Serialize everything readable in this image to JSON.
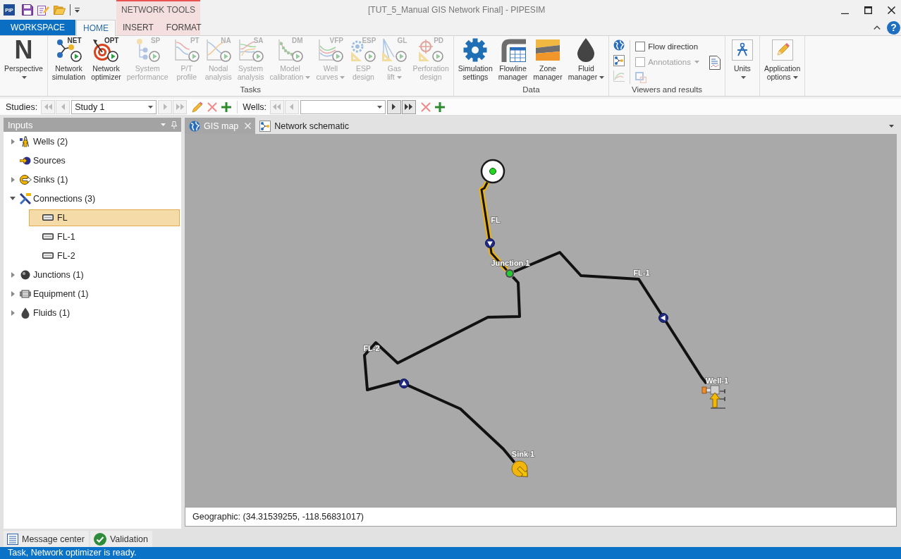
{
  "title_bar": {
    "app_logo": "PIP",
    "title": "[TUT_5_Manual GIS Network Final] - PIPESIM",
    "context_group": {
      "label": "NETWORK TOOLS"
    }
  },
  "ribbon_tabs": [
    {
      "label": "WORKSPACE",
      "kind": "backstage",
      "selected": false
    },
    {
      "label": "HOME",
      "kind": "normal",
      "selected": true
    },
    {
      "label": "INSERT",
      "kind": "contextual",
      "selected": false
    },
    {
      "label": "FORMAT",
      "kind": "contextual",
      "selected": false
    }
  ],
  "help": "?",
  "ribbon_groups": [
    {
      "kind": "large",
      "buttons": [
        {
          "kind": "perspective",
          "glyph": "N",
          "label": "Perspective",
          "dropdown": true,
          "disabled": false
        }
      ]
    },
    {
      "kind": "large",
      "label": "Tasks",
      "buttons": [
        {
          "kind": "network",
          "code": "NET",
          "label": "Network simulation",
          "dropdown": false,
          "disabled": false
        },
        {
          "kind": "target",
          "code": "OPT",
          "label": "Network optimizer",
          "dropdown": false,
          "disabled": false
        },
        {
          "kind": "system",
          "code": "SP",
          "label": "System performance",
          "dropdown": false,
          "disabled": true
        },
        {
          "kind": "profile",
          "code": "PT",
          "label": "P/T profile",
          "dropdown": false,
          "disabled": true
        },
        {
          "kind": "nodal",
          "code": "NA",
          "label": "Nodal analysis",
          "dropdown": false,
          "disabled": true
        },
        {
          "kind": "sensitivity",
          "code": "SA",
          "label": "System analysis",
          "dropdown": false,
          "disabled": true
        },
        {
          "kind": "calibration",
          "code": "DM",
          "label": "Model calibration",
          "dropdown": true,
          "disabled": true
        },
        {
          "kind": "curves",
          "code": "VFP",
          "label": "Well curves",
          "dropdown": true,
          "disabled": true
        },
        {
          "kind": "esp",
          "code": "ESP",
          "label": "ESP design",
          "dropdown": false,
          "disabled": true
        },
        {
          "kind": "gaslift",
          "code": "GL",
          "label": "Gas lift",
          "dropdown": true,
          "disabled": true
        },
        {
          "kind": "perforation",
          "code": "PD",
          "label": "Perforation design",
          "dropdown": false,
          "disabled": true
        }
      ]
    },
    {
      "kind": "large",
      "label": "Data",
      "buttons": [
        {
          "kind": "settings",
          "label": "Simulation settings",
          "dropdown": false,
          "disabled": false
        },
        {
          "kind": "flowlines",
          "label": "Flowline manager",
          "dropdown": false,
          "disabled": false
        },
        {
          "kind": "zones",
          "label": "Zone manager",
          "dropdown": false,
          "disabled": false
        },
        {
          "kind": "fluids",
          "label": "Fluid manager",
          "dropdown": true,
          "disabled": false
        }
      ]
    },
    {
      "kind": "viewers",
      "label": "Viewers and results",
      "view_buttons": [
        {
          "kind": "globe",
          "disabled": false
        },
        {
          "kind": "schematic",
          "disabled": false
        },
        {
          "kind": "chart",
          "disabled": true
        }
      ],
      "checkboxes": [
        {
          "label": "Flow direction",
          "checked": false,
          "disabled": false,
          "dropdown": false
        },
        {
          "label": "Annotations",
          "checked": false,
          "disabled": true,
          "dropdown": true
        }
      ],
      "overlay_button": {
        "disabled": true
      },
      "report_button": {
        "disabled": false
      }
    },
    {
      "kind": "large",
      "buttons": [
        {
          "kind": "units",
          "label": "Units",
          "dropdown": true,
          "disabled": false
        }
      ]
    },
    {
      "kind": "large",
      "buttons": [
        {
          "kind": "options",
          "label": "Application options",
          "dropdown": true,
          "disabled": false
        }
      ]
    }
  ],
  "toolbar": {
    "studies": {
      "label": "Studies:",
      "value": "Study 1",
      "nav": [
        {
          "kind": "first",
          "disabled": true
        },
        {
          "kind": "prev",
          "disabled": true
        },
        {
          "kind": "next",
          "disabled": true
        },
        {
          "kind": "last",
          "disabled": true
        }
      ],
      "actions": [
        {
          "kind": "edit"
        },
        {
          "kind": "delete"
        },
        {
          "kind": "add"
        }
      ]
    },
    "wells": {
      "label": "Wells:",
      "nav": [
        {
          "kind": "first",
          "disabled": true
        },
        {
          "kind": "prev",
          "disabled": true
        },
        {
          "kind": "next",
          "disabled": false
        },
        {
          "kind": "last",
          "disabled": false
        }
      ],
      "actions": [
        {
          "kind": "delete"
        },
        {
          "kind": "add"
        }
      ]
    }
  },
  "inputs_panel": {
    "title": "Inputs",
    "tree": [
      {
        "label": "Wells (2)",
        "kind": "well",
        "expanded": false,
        "selected": false
      },
      {
        "label": "Sources",
        "kind": "source",
        "selected": false
      },
      {
        "label": "Sinks (1)",
        "kind": "sink",
        "expanded": false,
        "selected": false
      },
      {
        "label": "Connections (3)",
        "kind": "connection",
        "expanded": true,
        "selected": false,
        "children": [
          {
            "label": "FL",
            "kind": "flowline",
            "selected": true
          },
          {
            "label": "FL-1",
            "kind": "flowline",
            "selected": false
          },
          {
            "label": "FL-2",
            "kind": "flowline",
            "selected": false
          }
        ]
      },
      {
        "label": "Junctions (1)",
        "kind": "junction",
        "expanded": false,
        "selected": false
      },
      {
        "label": "Equipment (1)",
        "kind": "equipment",
        "expanded": false,
        "selected": false
      },
      {
        "label": "Fluids (1)",
        "kind": "fluid",
        "expanded": false,
        "selected": false
      }
    ]
  },
  "document_tabs": [
    {
      "label": "GIS map",
      "kind": "globe",
      "selected": true,
      "closable": true
    },
    {
      "label": "Network schematic",
      "kind": "schematic",
      "selected": false,
      "closable": false
    }
  ],
  "map": {
    "nodes": [
      {
        "kind": "source"
      },
      {
        "kind": "junction",
        "label": "Junction 1"
      },
      {
        "kind": "well",
        "label": "Well-1"
      },
      {
        "kind": "sink",
        "label": "Sink 1"
      }
    ],
    "connections": [
      {
        "label": "FL",
        "selected": true
      },
      {
        "label": "FL-1",
        "selected": false
      },
      {
        "label": "FL-2",
        "selected": false
      }
    ]
  },
  "coordinates": "Geographic: (34.31539255, -118.56831017)",
  "bottom_tabs": [
    {
      "label": "Message center",
      "kind": "messages",
      "selected": false
    },
    {
      "label": "Validation",
      "kind": "validation",
      "selected": false
    }
  ],
  "status_bar": "Task, Network optimizer is ready."
}
